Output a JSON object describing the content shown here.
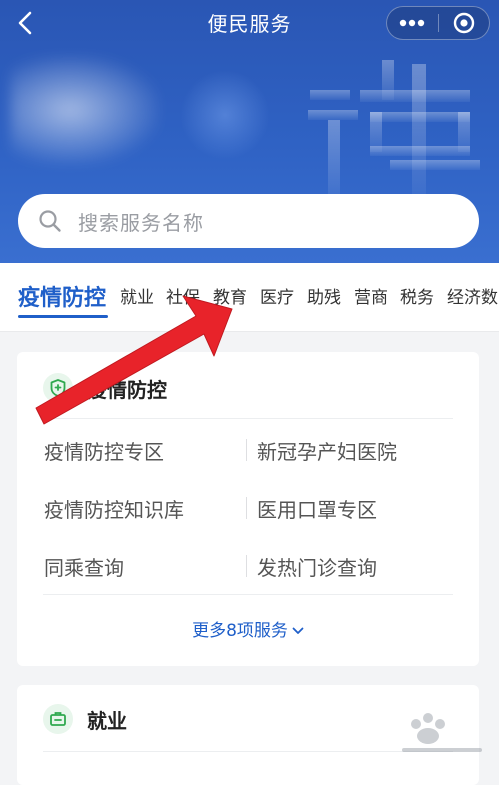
{
  "header": {
    "title": "便民服务"
  },
  "search": {
    "placeholder": "搜索服务名称"
  },
  "tabs": [
    {
      "label": "疫情防控",
      "active": true
    },
    {
      "label": "就业"
    },
    {
      "label": "社保"
    },
    {
      "label": "教育"
    },
    {
      "label": "医疗"
    },
    {
      "label": "助残"
    },
    {
      "label": "营商"
    },
    {
      "label": "税务"
    },
    {
      "label": "经济数"
    }
  ],
  "categories": [
    {
      "title": "疫情防控",
      "icon": "shield-icon",
      "services": [
        "疫情防控专区",
        "新冠孕产妇医院",
        "疫情防控知识库",
        "医用口罩专区",
        "同乘查询",
        "发热门诊查询"
      ],
      "more_label": "更多8项服务"
    },
    {
      "title": "就业",
      "icon": "briefcase-icon"
    }
  ],
  "colors": {
    "brand_blue": "#2f62c4",
    "accent": "#1f5fc9",
    "category_icon": "#2fa84f",
    "annotation_arrow": "#e8232a"
  }
}
